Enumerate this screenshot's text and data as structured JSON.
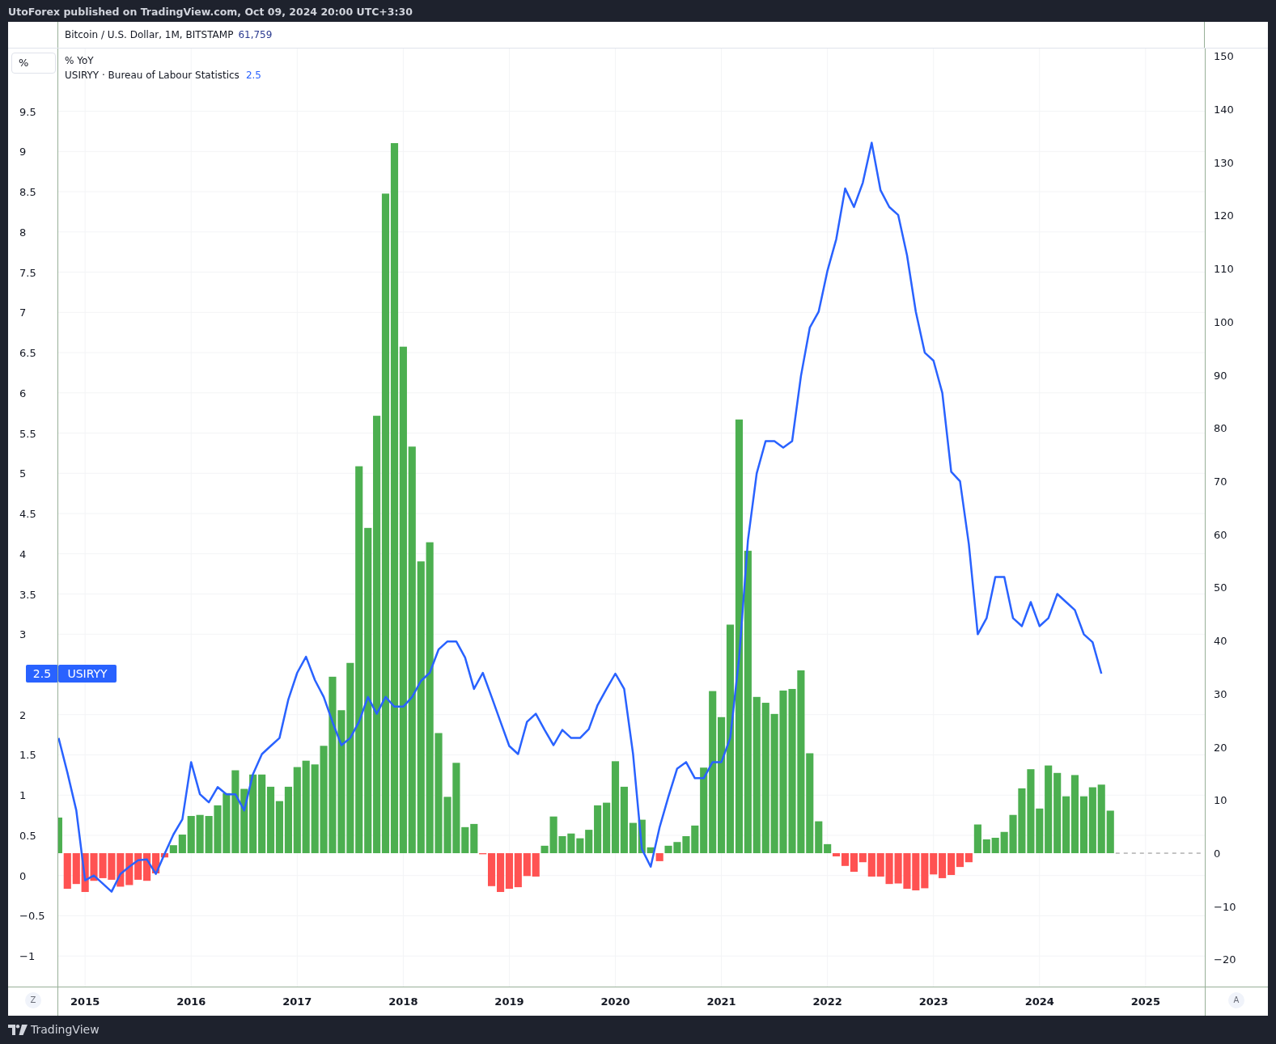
{
  "header": {
    "text": "UtoForex published on TradingView.com, Oct 09, 2024 20:00 UTC+3:30"
  },
  "main_legend": {
    "title": "Bitcoin / U.S. Dollar, 1M, BITSTAMP",
    "value": "61,759"
  },
  "pane": {
    "scale_button": "%",
    "legend": [
      {
        "title": "% YoY"
      },
      {
        "title": "USIRYY · Bureau of Labour Statistics",
        "value": "2.5"
      }
    ],
    "price_label": {
      "value": "2.5"
    },
    "chart_data": {
      "type": "bar",
      "x": [
        2014.75,
        2014.833,
        2014.917,
        2015,
        2015.083,
        2015.167,
        2015.25,
        2015.333,
        2015.417,
        2015.5,
        2015.583,
        2015.667,
        2015.75,
        2015.833,
        2015.917,
        2016,
        2016.083,
        2016.167,
        2016.25,
        2016.333,
        2016.417,
        2016.5,
        2016.583,
        2016.667,
        2016.75,
        2016.833,
        2016.917,
        2017,
        2017.083,
        2017.167,
        2017.25,
        2017.333,
        2017.417,
        2017.5,
        2017.583,
        2017.667,
        2017.75,
        2017.833,
        2017.917,
        2018,
        2018.083,
        2018.167,
        2018.25,
        2018.333,
        2018.417,
        2018.5,
        2018.583,
        2018.667,
        2018.75,
        2018.833,
        2018.917,
        2019,
        2019.083,
        2019.167,
        2019.25,
        2019.333,
        2019.417,
        2019.5,
        2019.583,
        2019.667,
        2019.75,
        2019.833,
        2019.917,
        2020,
        2020.083,
        2020.167,
        2020.25,
        2020.333,
        2020.417,
        2020.5,
        2020.583,
        2020.667,
        2020.75,
        2020.833,
        2020.917,
        2021,
        2021.083,
        2021.167,
        2021.25,
        2021.333,
        2021.417,
        2021.5,
        2021.583,
        2021.667,
        2021.75,
        2021.833,
        2021.917,
        2022,
        2022.083,
        2022.167,
        2022.25,
        2022.333,
        2022.417,
        2022.5,
        2022.583,
        2022.667,
        2022.75,
        2022.833,
        2022.917,
        2023,
        2023.083,
        2023.167,
        2023.25,
        2023.333,
        2023.417,
        2023.5,
        2023.583,
        2023.667,
        2023.75,
        2023.833,
        2023.917,
        2024,
        2024.083,
        2024.167,
        2024.25,
        2024.333,
        2024.417,
        2024.5,
        2024.583,
        2024.667
      ],
      "series": [
        {
          "axis": "y2",
          "color": "#4caf50",
          "values": [
            6.7,
            null,
            null,
            null,
            null,
            null,
            null,
            null,
            null,
            null,
            null,
            null,
            null,
            1.5,
            3.5,
            7.0,
            7.2,
            7.0,
            9.0,
            11.3,
            15.6,
            12.1,
            14.8,
            14.8,
            12.5,
            9.8,
            12.5,
            16.2,
            17.4,
            16.7,
            20.2,
            33.2,
            26.9,
            35.8,
            72.8,
            61.2,
            82.3,
            124.1,
            133.6,
            95.3,
            76.5,
            54.9,
            58.5,
            22.6,
            10.6,
            17.0,
            4.9,
            5.5,
            null,
            null,
            null,
            null,
            null,
            null,
            null,
            1.4,
            6.9,
            3.2,
            3.7,
            2.8,
            4.4,
            9.0,
            9.5,
            17.3,
            12.5,
            5.7,
            6.3,
            1.1,
            null,
            1.4,
            2.1,
            3.2,
            5.2,
            16.1,
            30.5,
            25.6,
            43.0,
            81.6,
            56.9,
            29.4,
            28.3,
            26.2,
            30.6,
            30.9,
            34.4,
            18.8,
            6.0,
            1.7,
            null,
            null,
            null,
            null,
            null,
            null,
            null,
            null,
            null,
            null,
            null,
            null,
            null,
            null,
            null,
            null,
            5.4,
            2.6,
            2.9,
            4.0,
            7.2,
            12.2,
            15.8,
            8.4,
            16.5,
            15.1,
            10.7,
            14.7,
            10.7,
            12.4,
            12.9,
            8.0
          ]
        },
        {
          "axis": "y2",
          "color": "#ff5252",
          "values": [
            null,
            -6.7,
            -5.8,
            -7.3,
            -5.2,
            -4.7,
            -5,
            -6.3,
            -6,
            -5,
            -5.2,
            -3.8,
            -0.8,
            null,
            null,
            null,
            null,
            null,
            null,
            null,
            null,
            null,
            null,
            null,
            null,
            null,
            null,
            null,
            null,
            null,
            null,
            null,
            null,
            null,
            null,
            null,
            null,
            null,
            null,
            null,
            null,
            null,
            null,
            null,
            null,
            null,
            null,
            null,
            -0.2,
            -6.2,
            -7.3,
            -6.7,
            -6.4,
            -4.3,
            -4.4,
            null,
            null,
            null,
            null,
            null,
            null,
            null,
            null,
            null,
            null,
            null,
            null,
            null,
            -1.5,
            null,
            null,
            null,
            null,
            null,
            null,
            null,
            null,
            null,
            null,
            null,
            null,
            null,
            null,
            null,
            null,
            null,
            null,
            null,
            -0.6,
            -2.4,
            -3.5,
            -1.7,
            -4.4,
            -4.4,
            -5.8,
            -5.7,
            -6.7,
            -7.0,
            -6.6,
            -4.0,
            -4.7,
            -4.1,
            -2.6,
            -1.7,
            null,
            null,
            null,
            null,
            null,
            null,
            null,
            null,
            null,
            null,
            null,
            null,
            null,
            null,
            null,
            null
          ]
        },
        {
          "name": "USIRYY",
          "type": "line",
          "color": "#2962ff",
          "values": [
            1.71,
            1.28,
            0.81,
            -0.06,
            0.0,
            -0.1,
            -0.2,
            0.02,
            0.11,
            0.19,
            0.2,
            0.02,
            0.27,
            0.51,
            0.7,
            1.41,
            1.01,
            0.91,
            1.1,
            1.01,
            1.01,
            0.81,
            1.26,
            1.51,
            1.61,
            1.71,
            2.19,
            2.52,
            2.72,
            2.43,
            2.22,
            1.91,
            1.62,
            1.71,
            1.91,
            2.22,
            2.01,
            2.22,
            2.1,
            2.1,
            2.22,
            2.42,
            2.52,
            2.81,
            2.91,
            2.91,
            2.71,
            2.32,
            2.52,
            2.22,
            1.91,
            1.61,
            1.51,
            1.91,
            2.01,
            1.81,
            1.62,
            1.81,
            1.71,
            1.71,
            1.82,
            2.12,
            2.32,
            2.51,
            2.32,
            1.51,
            0.33,
            0.11,
            0.6,
            0.98,
            1.33,
            1.41,
            1.21,
            1.21,
            1.41,
            1.41,
            1.71,
            2.71,
            4.17,
            5.0,
            5.4,
            5.4,
            5.32,
            5.4,
            6.21,
            6.81,
            7.01,
            7.52,
            7.91,
            8.54,
            8.31,
            8.61,
            9.11,
            8.52,
            8.31,
            8.21,
            7.71,
            7.01,
            6.5,
            6.4,
            6.0,
            5.02,
            4.9,
            4.12,
            3.0,
            3.2,
            3.71,
            3.71,
            3.2,
            3.1,
            3.4,
            3.1,
            3.2,
            3.5,
            3.4,
            3.3,
            3.0,
            2.9,
            2.51,
            null
          ]
        }
      ],
      "xlim": [
        2014.274,
        2026.153
      ],
      "grid": true,
      "xticks": [
        2015,
        2016,
        2017,
        2018,
        2019,
        2020,
        2021,
        2022,
        2023,
        2024,
        2025
      ],
      "ylim": [
        -1.38,
        10.28
      ],
      "yticks": [
        {
          "value": -1,
          "label": "−1"
        },
        {
          "value": -0.5,
          "label": "−0.5"
        },
        0,
        0.5,
        1,
        1.5,
        2,
        3,
        3.5,
        4,
        4.5,
        5,
        5.5,
        6,
        6.5,
        7,
        7.5,
        8,
        8.5,
        9,
        9.5
      ],
      "y2lim": [
        -25.1,
        151.4
      ],
      "y2ticks": [
        {
          "value": -20,
          "label": "−20"
        },
        {
          "value": -10,
          "label": "−10"
        },
        0,
        10,
        20,
        30,
        40,
        50,
        60,
        70,
        80,
        90,
        100,
        110,
        120,
        130,
        140,
        150
      ]
    }
  },
  "time_axis": {
    "left_button": "Z",
    "right_button": "A"
  },
  "footer": {
    "brand": "TradingView"
  }
}
